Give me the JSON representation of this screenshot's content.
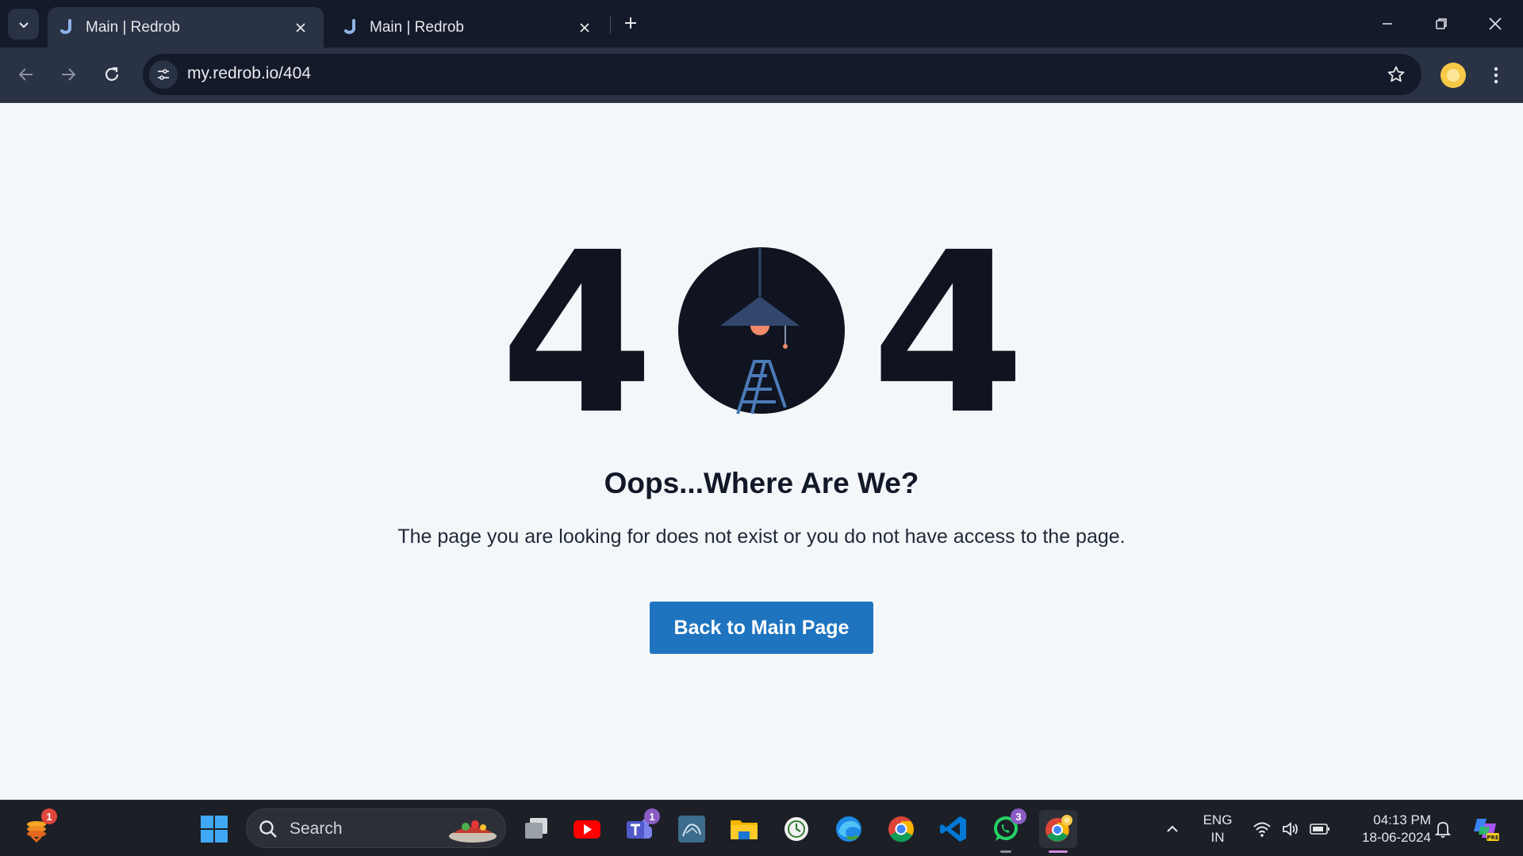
{
  "browser": {
    "tabs": [
      {
        "title": "Main | Redrob",
        "active": true
      },
      {
        "title": "Main | Redrob",
        "active": false
      }
    ],
    "url": "my.redrob.io/404"
  },
  "page": {
    "digits": [
      "4",
      "4"
    ],
    "headline": "Oops...Where Are We?",
    "message": "The page you are looking for does not exist or you do not have access to the page.",
    "button_label": "Back to Main Page",
    "colors": {
      "dark": "#0f1420",
      "accent": "#1f74bf",
      "lamp": "#33466e",
      "bulb": "#f08a6a",
      "ladder": "#4b7ab8"
    }
  },
  "taskbar": {
    "search_placeholder": "Search",
    "badges": {
      "widgets": "1",
      "teams": "1",
      "whatsapp": "3"
    },
    "lang_top": "ENG",
    "lang_bottom": "IN",
    "time": "04:13 PM",
    "date": "18-06-2024",
    "icons": [
      "widgets-icon",
      "windows-start-icon",
      "search-icon",
      "task-view-icon",
      "youtube-icon",
      "teams-icon",
      "mysql-workbench-icon",
      "file-explorer-icon",
      "clock-app-icon",
      "edge-icon",
      "chrome-icon",
      "vscode-icon",
      "whatsapp-icon",
      "chrome-profile-icon",
      "chevron-up-icon",
      "wifi-icon",
      "volume-icon",
      "battery-icon",
      "bell-icon",
      "copilot-icon"
    ]
  }
}
